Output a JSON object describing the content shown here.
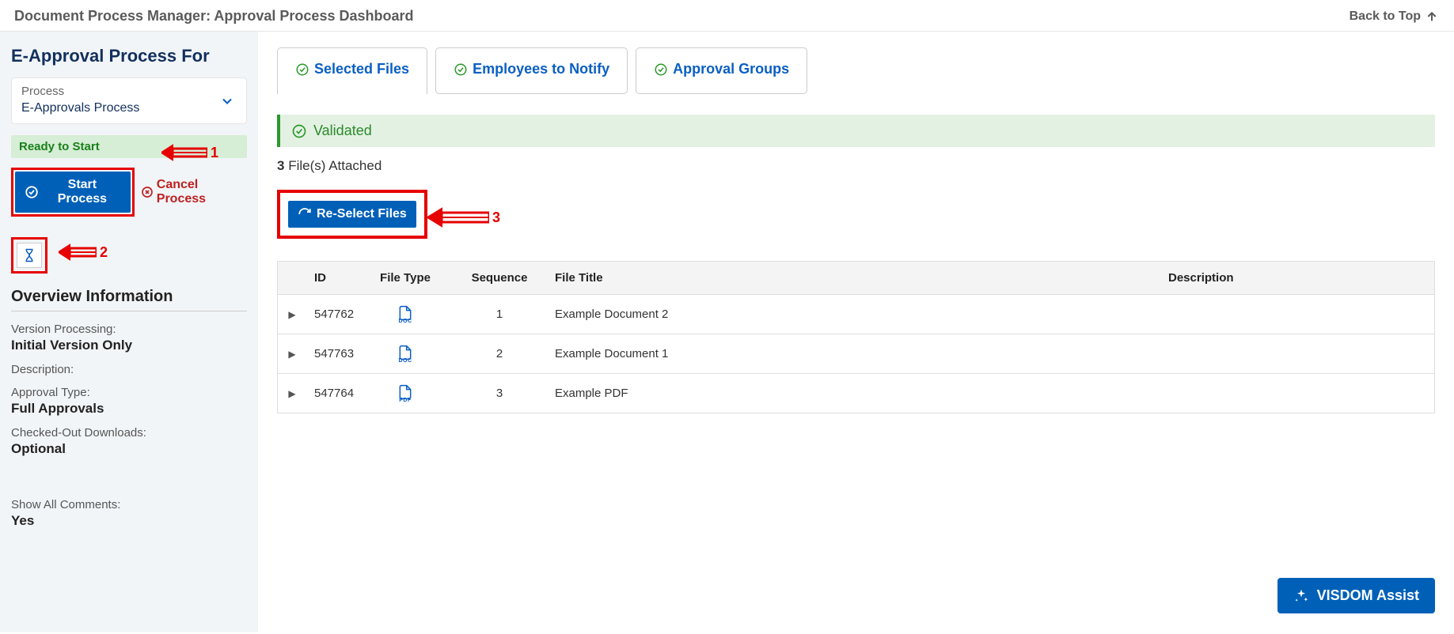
{
  "header": {
    "title": "Document Process Manager: Approval Process Dashboard",
    "back_to_top": "Back to Top"
  },
  "sidebar": {
    "heading": "E-Approval Process For",
    "process_label": "Process",
    "process_value": "E-Approvals Process",
    "status": "Ready to Start",
    "start_btn": "Start Process",
    "cancel_btn": "Cancel Process",
    "overview_heading": "Overview Information",
    "info": [
      {
        "label": "Version Processing:",
        "value": "Initial Version Only"
      },
      {
        "label": "Description:",
        "value": ""
      },
      {
        "label": "Approval Type:",
        "value": "Full Approvals"
      },
      {
        "label": "Checked-Out Downloads:",
        "value": "Optional"
      }
    ],
    "show_comments_label": "Show All Comments:",
    "show_comments_value": "Yes"
  },
  "annotations": {
    "a1": "1",
    "a2": "2",
    "a3": "3"
  },
  "main": {
    "tabs": [
      {
        "label": "Selected Files"
      },
      {
        "label": "Employees to Notify"
      },
      {
        "label": "Approval Groups"
      }
    ],
    "validated": "Validated",
    "files_count": "3",
    "files_count_suffix": " File(s) Attached",
    "reselect_btn": "Re-Select Files",
    "table": {
      "headers": {
        "id": "ID",
        "type": "File Type",
        "seq": "Sequence",
        "title": "File Title",
        "desc": "Description"
      },
      "rows": [
        {
          "id": "547762",
          "type": "DOC",
          "seq": "1",
          "title": "Example Document 2",
          "desc": ""
        },
        {
          "id": "547763",
          "type": "DOC",
          "seq": "2",
          "title": "Example Document 1",
          "desc": ""
        },
        {
          "id": "547764",
          "type": "PDF",
          "seq": "3",
          "title": "Example PDF",
          "desc": ""
        }
      ]
    },
    "visdom": "VISDOM Assist"
  }
}
